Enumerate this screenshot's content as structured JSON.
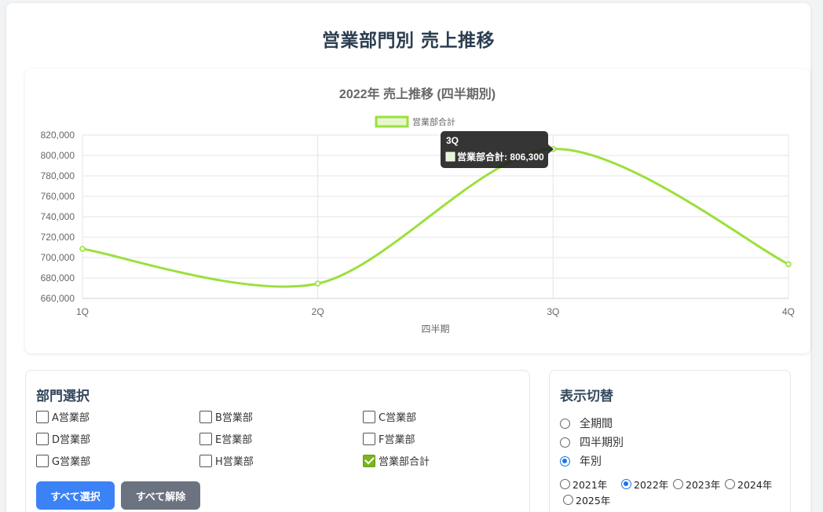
{
  "page": {
    "title": "営業部門別 売上推移"
  },
  "chart_data": {
    "type": "line",
    "title": "2022年 売上推移 (四半期別)",
    "xlabel": "四半期",
    "ylabel": "",
    "categories": [
      "1Q",
      "2Q",
      "3Q",
      "4Q"
    ],
    "series": [
      {
        "name": "営業部合計",
        "values": [
          708500,
          674500,
          806300,
          693500
        ],
        "color": "#9be03c"
      }
    ],
    "ylim": [
      660000,
      820000
    ],
    "yticks": [
      "820,000",
      "800,000",
      "780,000",
      "760,000",
      "740,000",
      "720,000",
      "700,000",
      "680,000",
      "660,000"
    ],
    "grid": true,
    "legend": "top",
    "tooltip": {
      "title": "3Q",
      "label": "営業部合計: 806,300",
      "index": 2
    }
  },
  "departments": {
    "title": "部門選択",
    "items": [
      {
        "label": "A営業部",
        "checked": false
      },
      {
        "label": "B営業部",
        "checked": false
      },
      {
        "label": "C営業部",
        "checked": false
      },
      {
        "label": "D営業部",
        "checked": false
      },
      {
        "label": "E営業部",
        "checked": false
      },
      {
        "label": "F営業部",
        "checked": false
      },
      {
        "label": "G営業部",
        "checked": false
      },
      {
        "label": "H営業部",
        "checked": false
      },
      {
        "label": "営業部合計",
        "checked": true
      }
    ],
    "select_all_label": "すべて選択",
    "clear_all_label": "すべて解除"
  },
  "view": {
    "title": "表示切替",
    "modes": [
      {
        "label": "全期間",
        "checked": false
      },
      {
        "label": "四半期別",
        "checked": false
      },
      {
        "label": "年別",
        "checked": true
      }
    ],
    "years": [
      {
        "label": "2021年",
        "checked": false
      },
      {
        "label": "2022年",
        "checked": true
      },
      {
        "label": "2023年",
        "checked": false
      },
      {
        "label": "2024年",
        "checked": false
      },
      {
        "label": "2025年",
        "checked": false
      }
    ]
  },
  "colors": {
    "accent": "#3b82f6",
    "secondary": "#6b7280",
    "series": "#9be03c",
    "check": "#7ab51d"
  }
}
